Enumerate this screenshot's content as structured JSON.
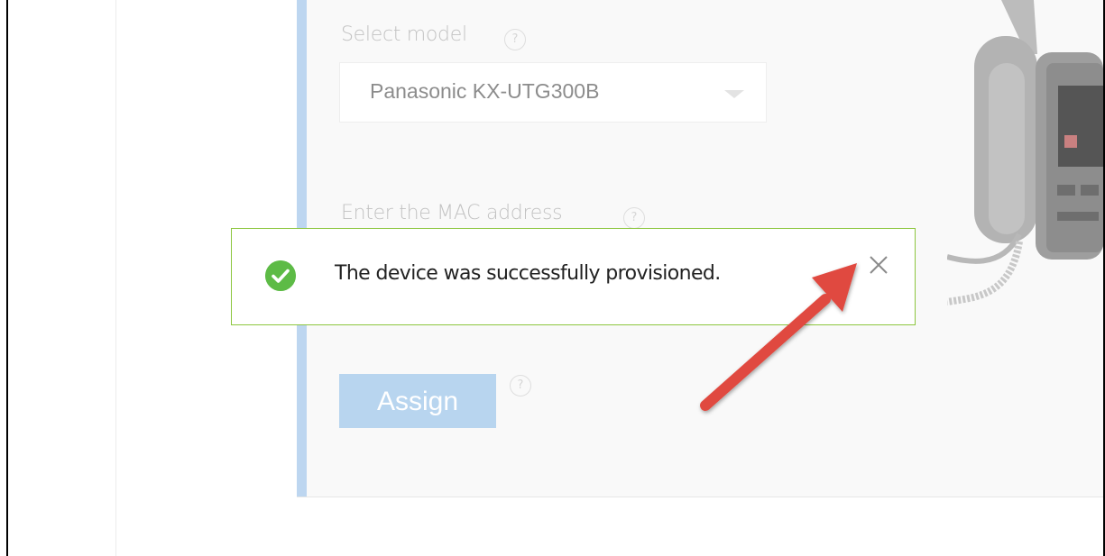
{
  "form": {
    "model_label": "Select model",
    "model_help": "?",
    "model_value": "Panasonic KX-UTG300B",
    "mac_label": "Enter the MAC address",
    "mac_help": "?",
    "assign_label": "Assign",
    "assign_help": "?"
  },
  "toast": {
    "message": "The device was successfully provisioned.",
    "icon": "check-circle-icon",
    "close_icon": "close-icon"
  },
  "annotation": {
    "arrow_icon": "red-arrow-icon",
    "arrow_color": "#e04a3f"
  },
  "colors": {
    "accent": "#bdd6f0",
    "success_border": "#8cc63e",
    "success_check": "#5dbb46",
    "button": "#b8d5ef"
  }
}
